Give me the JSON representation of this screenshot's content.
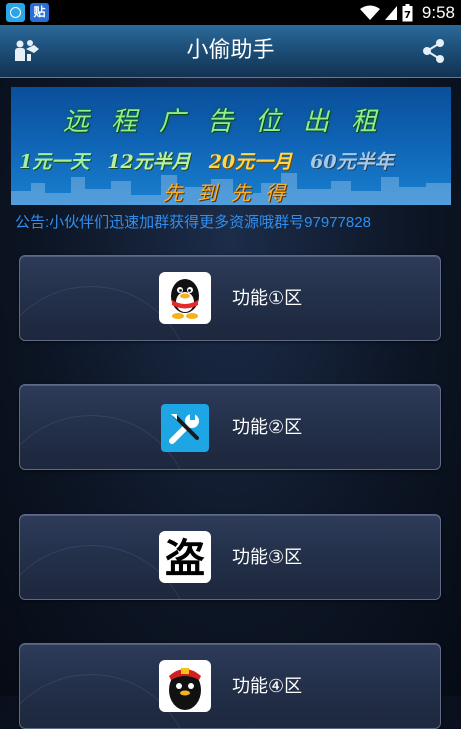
{
  "status_bar": {
    "app_badge_text": "贴",
    "time": "9:58",
    "battery_label": "7"
  },
  "header": {
    "title": "小偷助手"
  },
  "banner": {
    "line1": "远程广告位出租",
    "prices": [
      "1元一天",
      "12元半月",
      "20元一月",
      "60元半年"
    ],
    "line3": "先到先得"
  },
  "notice": "公告:小伙伴们迅速加群获得更多资源哦群号97977828",
  "features": [
    {
      "label": "功能①区",
      "icon": "qq-penguin-icon"
    },
    {
      "label": "功能②区",
      "icon": "tools-icon"
    },
    {
      "label": "功能③区",
      "icon": "dao-character-icon"
    },
    {
      "label": "功能④区",
      "icon": "qq-penguin-hat-icon"
    }
  ],
  "colors": {
    "notice": "#2f8ff0",
    "titlebar": "#1d4f79",
    "tools_icon_bg": "#1ea6e4"
  }
}
